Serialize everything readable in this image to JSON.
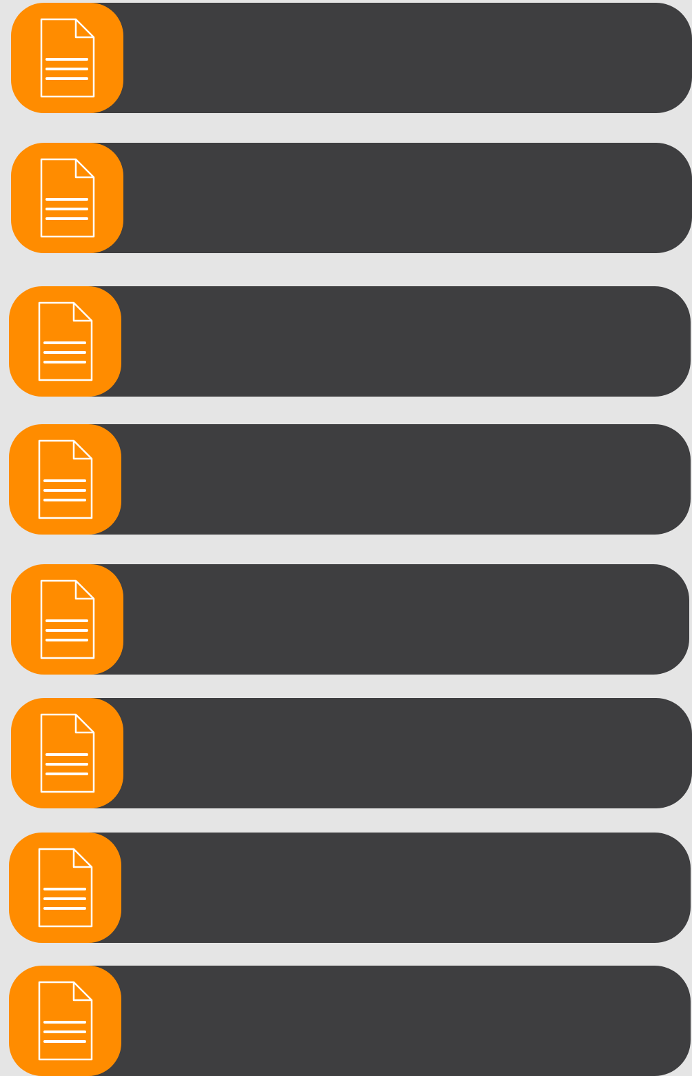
{
  "items": [
    {
      "label": "",
      "icon": "document-icon"
    },
    {
      "label": "",
      "icon": "document-icon"
    },
    {
      "label": "",
      "icon": "document-icon"
    },
    {
      "label": "",
      "icon": "document-icon"
    },
    {
      "label": "",
      "icon": "document-icon"
    },
    {
      "label": "",
      "icon": "document-icon"
    },
    {
      "label": "",
      "icon": "document-icon"
    },
    {
      "label": "",
      "icon": "document-icon"
    }
  ],
  "colors": {
    "background": "#e5e5e5",
    "bar": "#3e3e40",
    "accent": "#ff8c00",
    "icon_stroke": "#ffffff"
  }
}
